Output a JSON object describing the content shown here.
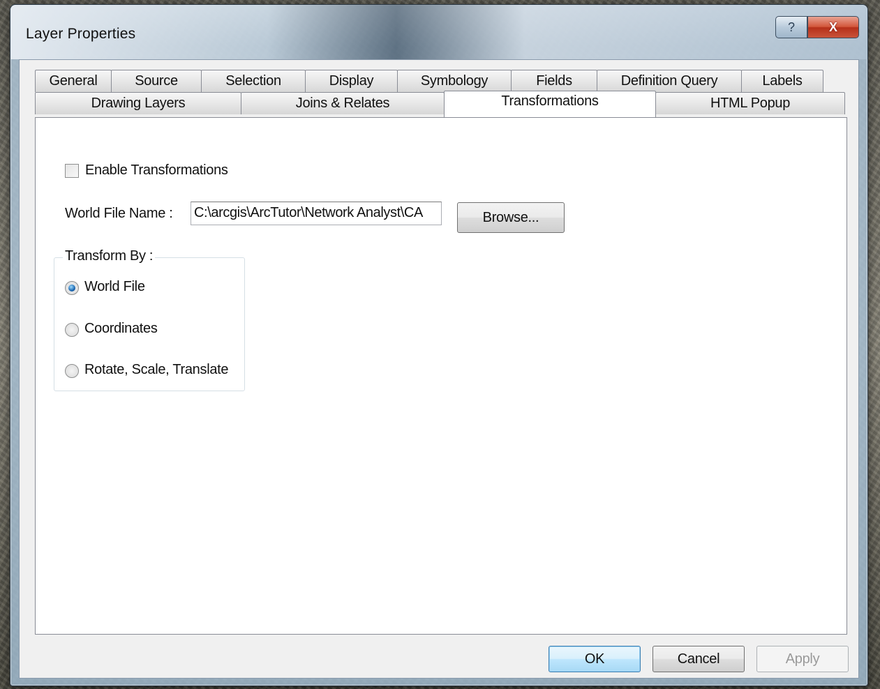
{
  "window": {
    "title": "Layer Properties",
    "help_label": "?",
    "close_label": "X"
  },
  "tabs": {
    "row1": [
      "General",
      "Source",
      "Selection",
      "Display",
      "Symbology",
      "Fields",
      "Definition Query",
      "Labels"
    ],
    "row2": [
      "Drawing Layers",
      "Joins & Relates",
      "Transformations",
      "HTML Popup"
    ],
    "active": "Transformations"
  },
  "transformations": {
    "enable_label": "Enable Transformations",
    "enable_checked": false,
    "world_file_label": "World File Name :",
    "world_file_value": "C:\\arcgis\\ArcTutor\\Network Analyst\\CA",
    "browse_label": "Browse...",
    "transform_by_label": "Transform By :",
    "options": [
      "World File",
      "Coordinates",
      "Rotate, Scale, Translate"
    ],
    "selected_option": "World File"
  },
  "footer": {
    "ok_label": "OK",
    "cancel_label": "Cancel",
    "apply_label": "Apply"
  }
}
